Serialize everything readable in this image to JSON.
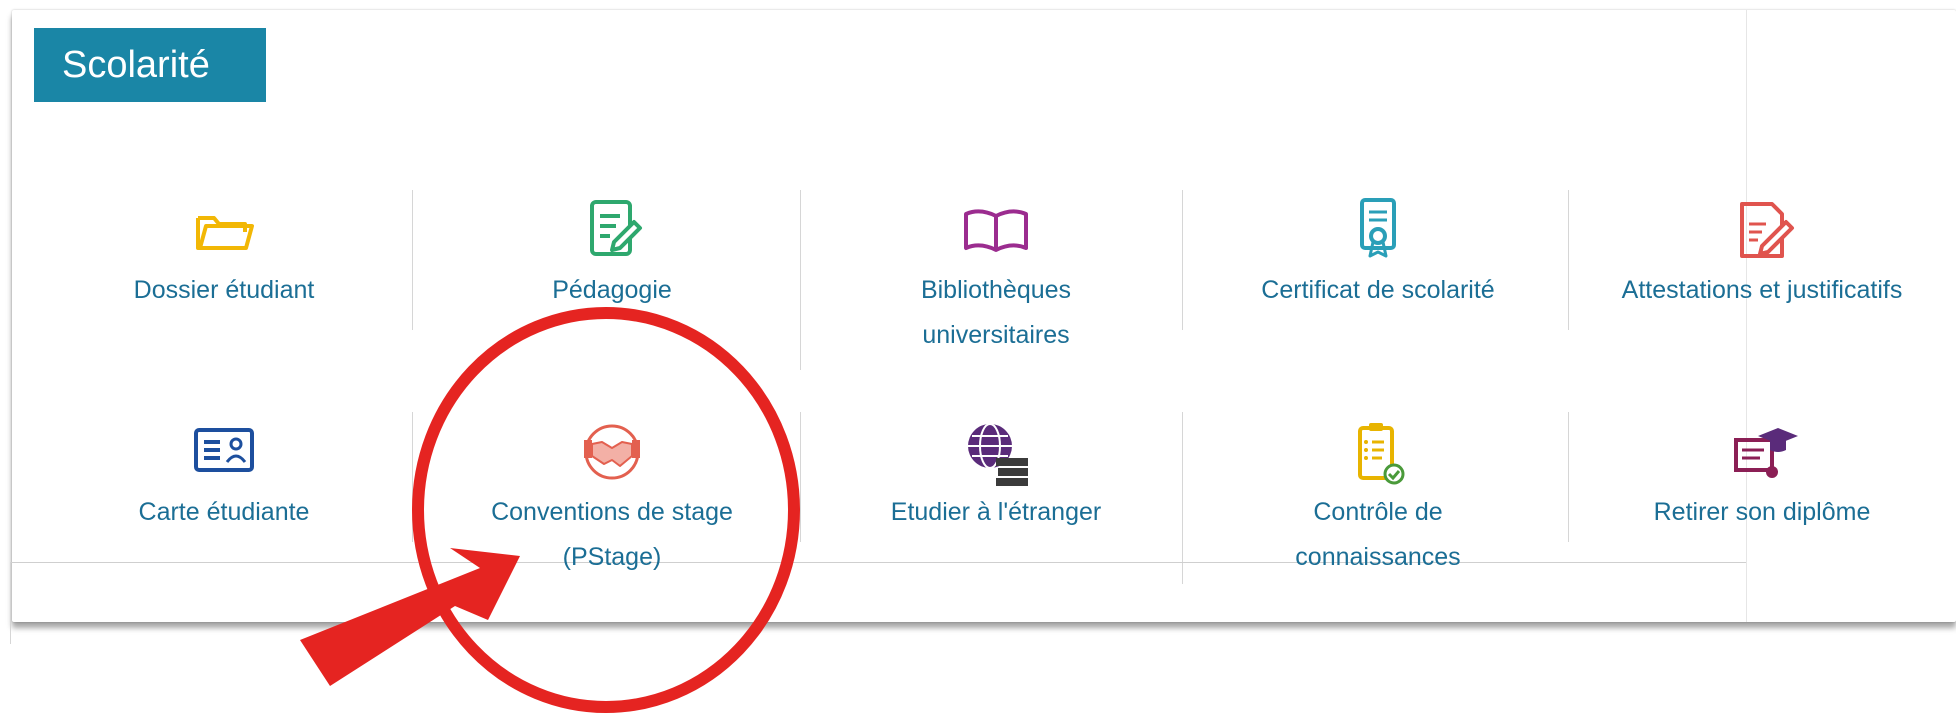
{
  "section": {
    "title": "Scolarité"
  },
  "tiles": [
    {
      "label": "Dossier étudiant",
      "icon": "folder-icon",
      "color": "#f2b705"
    },
    {
      "label": "Pédagogie",
      "icon": "document-edit-icon",
      "color": "#2ea86e"
    },
    {
      "label": "Bibliothèques universitaires",
      "icon": "open-book-icon",
      "color": "#9b2c8f"
    },
    {
      "label": "Certificat de scolarité",
      "icon": "certificate-icon",
      "color": "#2a9fb8"
    },
    {
      "label": "Attestations et justificatifs",
      "icon": "form-pencil-icon",
      "color": "#e0544e"
    },
    {
      "label": "Carte étudiante",
      "icon": "id-card-icon",
      "color": "#1d4f9e"
    },
    {
      "label": "Conventions de stage (PStage)",
      "icon": "handshake-icon",
      "color": "#e3604f"
    },
    {
      "label": "Etudier à l'étranger",
      "icon": "globe-books-icon",
      "color": "#5a2b7a"
    },
    {
      "label": "Contrôle de connaissances",
      "icon": "clipboard-check-icon",
      "color": "#e8b400"
    },
    {
      "label": "Retirer son diplôme",
      "icon": "diploma-icon",
      "color": "#8b1f55"
    }
  ],
  "annotation": {
    "circle_color": "#e52421",
    "arrow_color": "#e52421"
  }
}
